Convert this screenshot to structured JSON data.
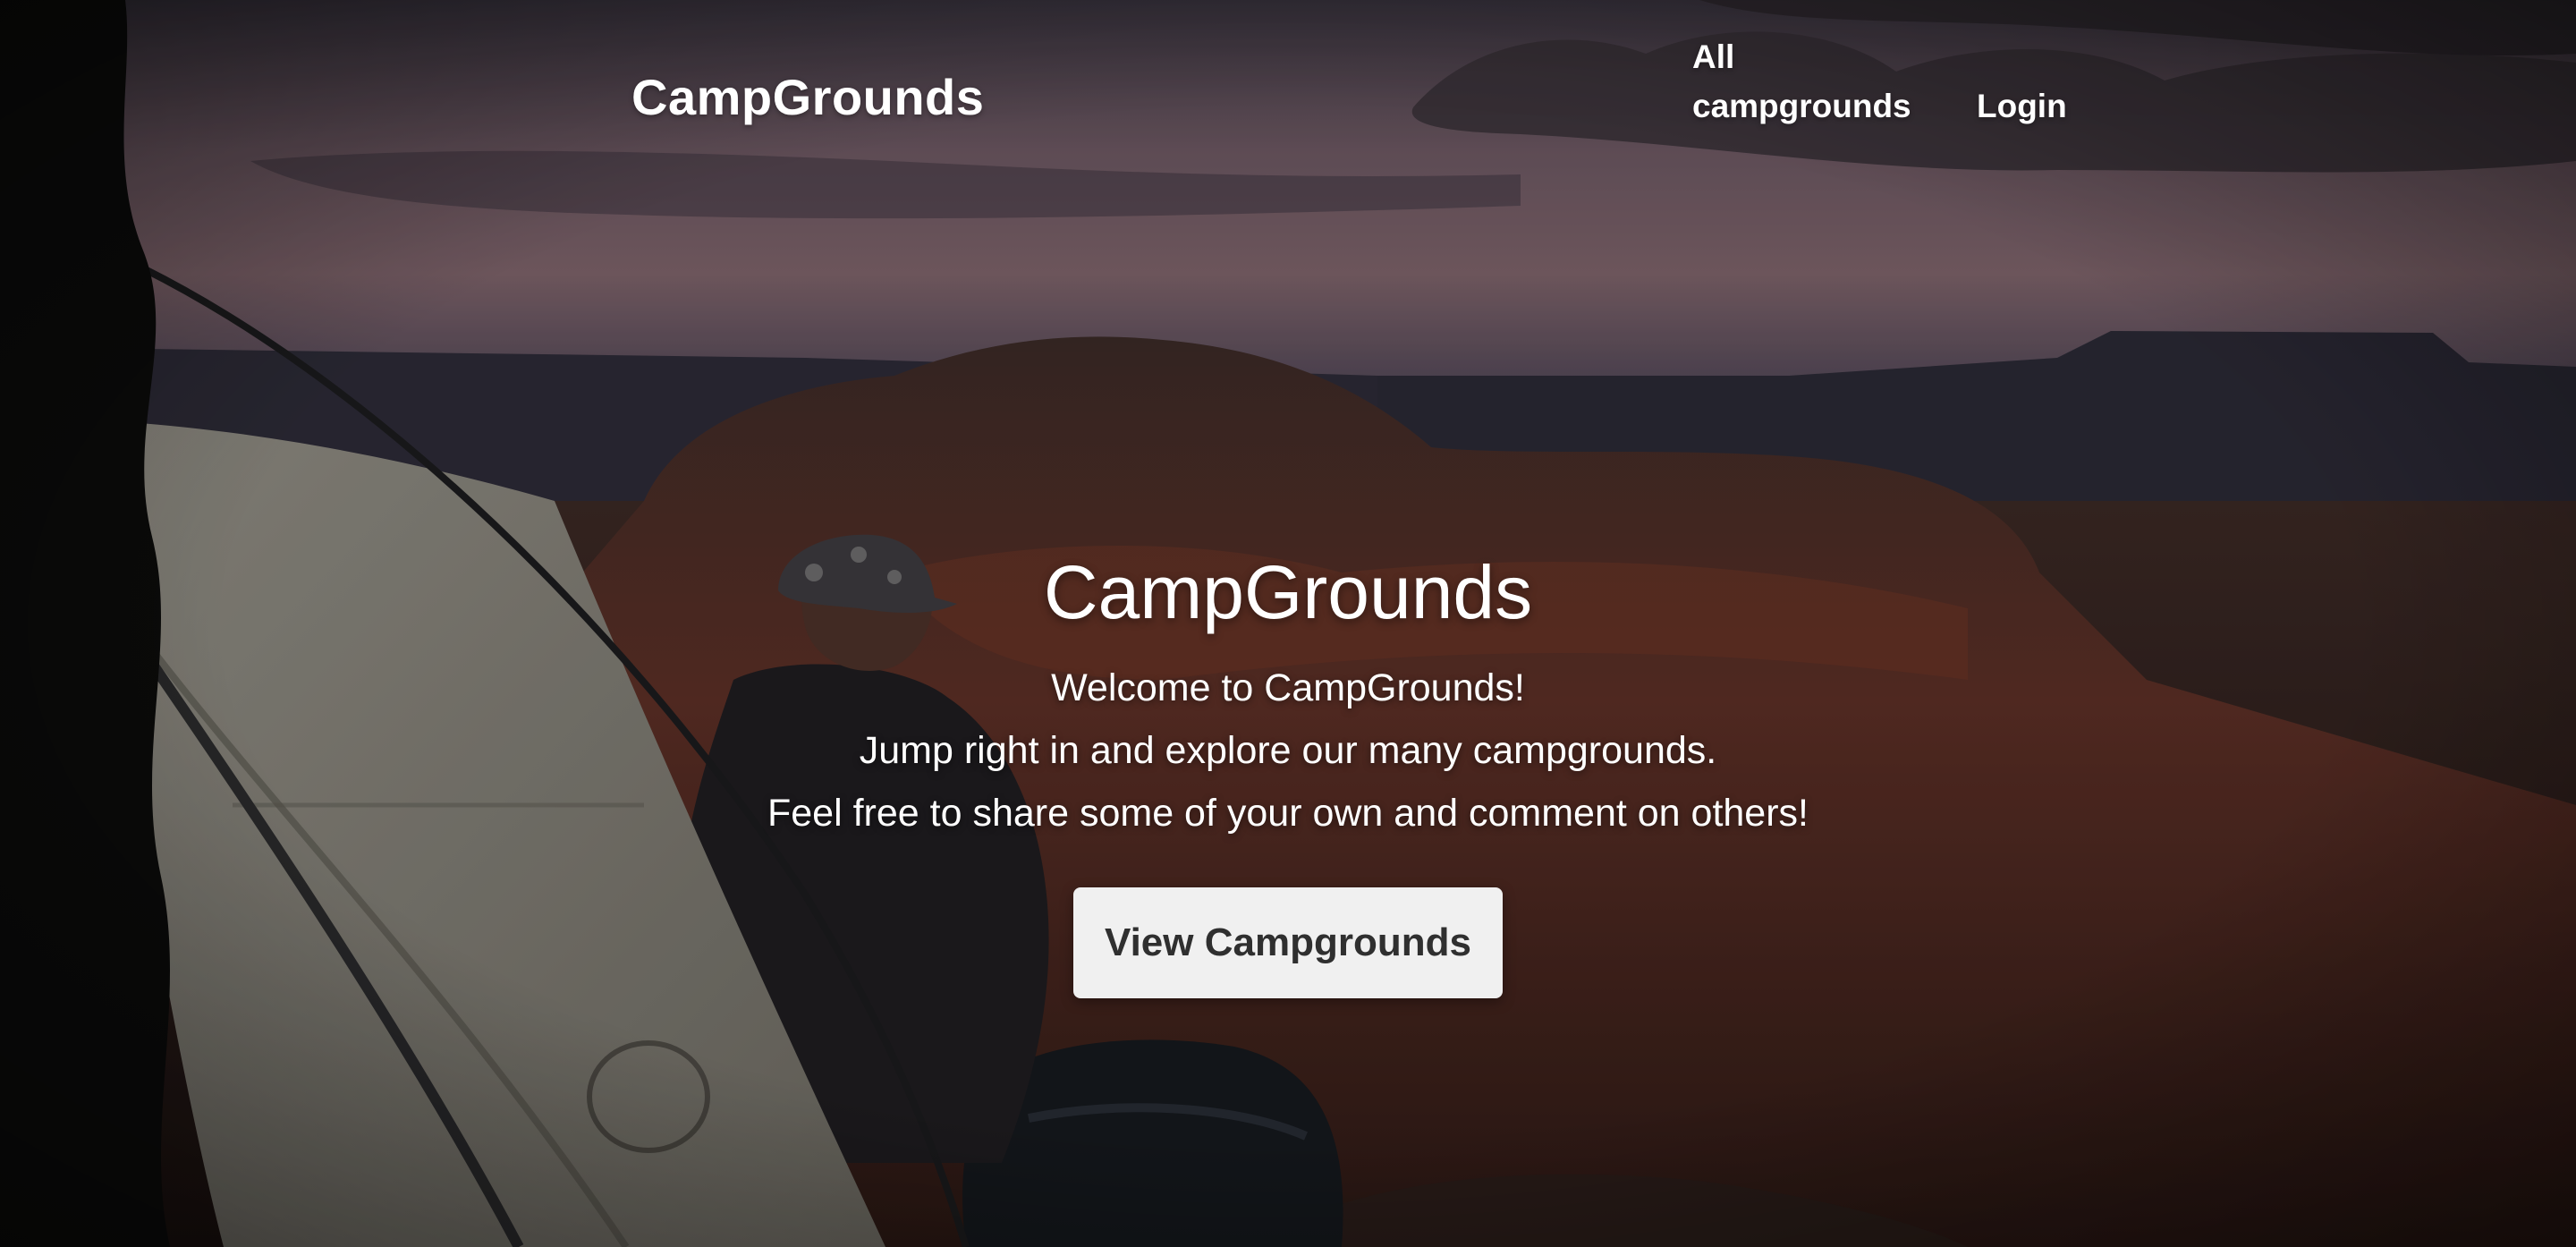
{
  "header": {
    "brand": "CampGrounds",
    "nav": {
      "all_campgrounds": "All campgrounds",
      "login": "Login"
    }
  },
  "hero": {
    "title": "CampGrounds",
    "lines": [
      "Welcome to CampGrounds!",
      "Jump right in and explore our many campgrounds.",
      "Feel free to share some of your own and comment on others!"
    ],
    "cta_label": "View Campgrounds"
  },
  "theme": {
    "text_color": "#ffffff",
    "button_bg": "#f0f0f0",
    "button_text": "#2f2f2f"
  }
}
